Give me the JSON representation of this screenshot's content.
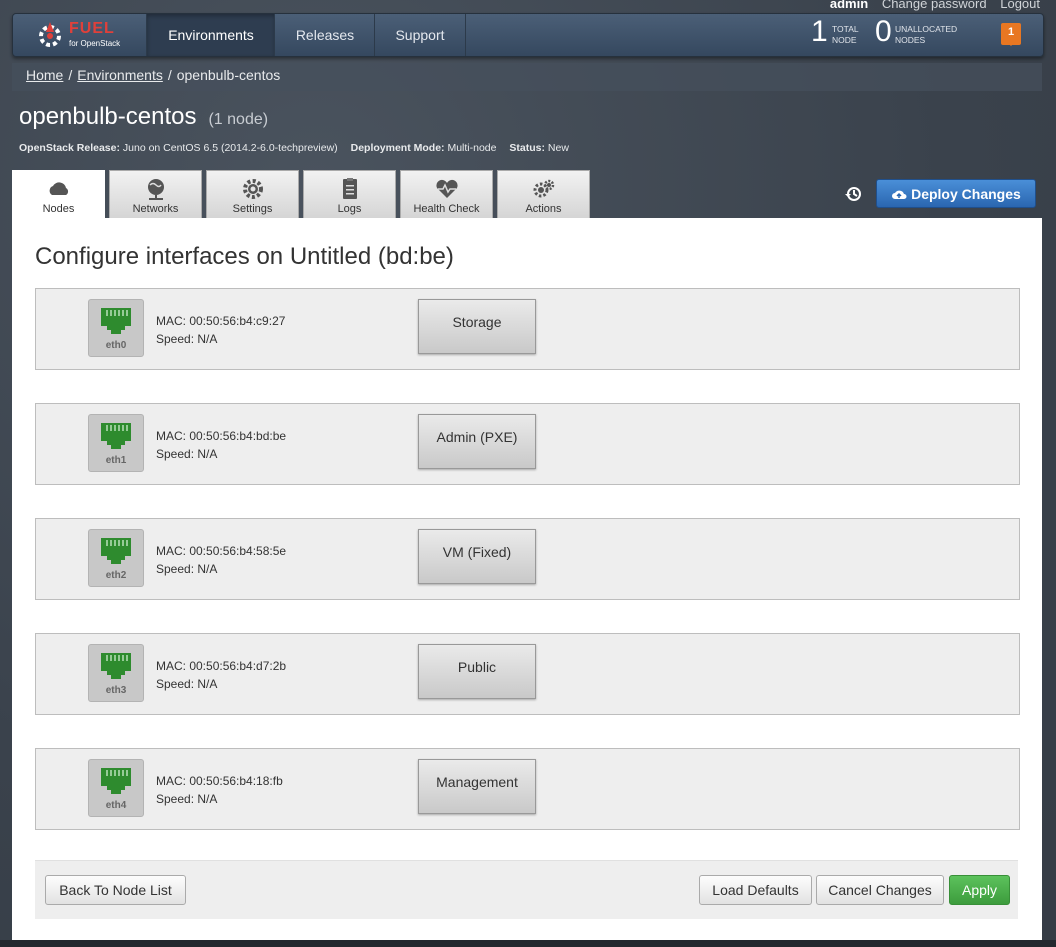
{
  "user": {
    "name": "admin",
    "change_password": "Change password",
    "logout": "Logout"
  },
  "brand": {
    "name": "FUEL",
    "sub": "for OpenStack"
  },
  "nav": {
    "items": [
      {
        "label": "Environments"
      },
      {
        "label": "Releases"
      },
      {
        "label": "Support"
      }
    ]
  },
  "stats": {
    "total_nodes": {
      "value": "1",
      "label_1": "TOTAL",
      "label_2": "NODE"
    },
    "unallocated": {
      "value": "0",
      "label_1": "UNALLOCATED",
      "label_2": "NODES"
    },
    "notifications": "1"
  },
  "breadcrumb": {
    "home": "Home",
    "environments": "Environments",
    "current": "openbulb-centos"
  },
  "env": {
    "name": "openbulb-centos",
    "node_count": "(1 node)",
    "release_label": "OpenStack Release:",
    "release_value": "Juno on CentOS 6.5 (2014.2-6.0-techpreview)",
    "mode_label": "Deployment Mode:",
    "mode_value": "Multi-node",
    "status_label": "Status:",
    "status_value": "New"
  },
  "tabs": [
    {
      "label": "Nodes",
      "icon": "cloud-icon"
    },
    {
      "label": "Networks",
      "icon": "globe-icon"
    },
    {
      "label": "Settings",
      "icon": "gear-icon"
    },
    {
      "label": "Logs",
      "icon": "clipboard-icon"
    },
    {
      "label": "Health Check",
      "icon": "heartbeat-icon"
    },
    {
      "label": "Actions",
      "icon": "cogs-icon"
    }
  ],
  "deploy_button": "Deploy Changes",
  "page": {
    "heading": "Configure interfaces on Untitled (bd:be)"
  },
  "interfaces": [
    {
      "name": "eth0",
      "mac": "MAC: 00:50:56:b4:c9:27",
      "speed": "Speed: N/A",
      "network": "Storage"
    },
    {
      "name": "eth1",
      "mac": "MAC: 00:50:56:b4:bd:be",
      "speed": "Speed: N/A",
      "network": "Admin (PXE)"
    },
    {
      "name": "eth2",
      "mac": "MAC: 00:50:56:b4:58:5e",
      "speed": "Speed: N/A",
      "network": "VM (Fixed)"
    },
    {
      "name": "eth3",
      "mac": "MAC: 00:50:56:b4:d7:2b",
      "speed": "Speed: N/A",
      "network": "Public"
    },
    {
      "name": "eth4",
      "mac": "MAC: 00:50:56:b4:18:fb",
      "speed": "Speed: N/A",
      "network": "Management"
    }
  ],
  "footer": {
    "back": "Back To Node List",
    "load_defaults": "Load Defaults",
    "cancel": "Cancel Changes",
    "apply": "Apply"
  },
  "colors": {
    "port_green": "#2e8b2e",
    "apply_green": "#4cae4c",
    "deploy_blue": "#2f6db5"
  }
}
